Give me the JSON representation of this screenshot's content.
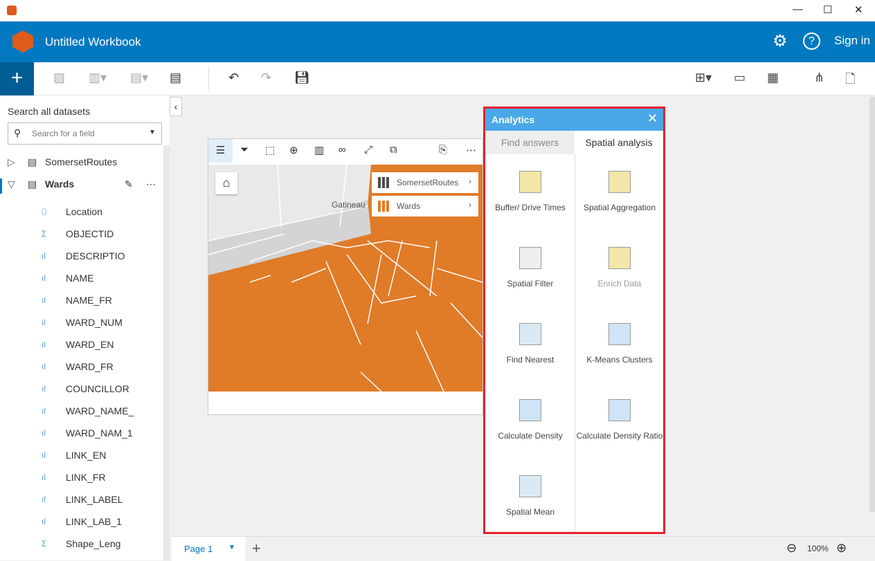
{
  "window": {
    "title": "Untitled Workbook",
    "minimize": "—",
    "maximize": "☐",
    "close": "✕"
  },
  "header": {
    "title": "Untitled Workbook",
    "sign_in": "Sign in",
    "settings_icon": "gear-icon",
    "help_icon": "help-icon"
  },
  "toolbar": {
    "add": "+"
  },
  "sidebar": {
    "search_label": "Search all datasets",
    "search_placeholder": "Search for a field",
    "datasets": [
      {
        "name": "SomersetRoutes"
      },
      {
        "name": "Wards"
      }
    ],
    "fields": [
      {
        "name": "Location",
        "type": "location"
      },
      {
        "name": "OBJECTID",
        "type": "number"
      },
      {
        "name": "DESCRIPTIO",
        "type": "string"
      },
      {
        "name": "NAME",
        "type": "string"
      },
      {
        "name": "NAME_FR",
        "type": "string"
      },
      {
        "name": "WARD_NUM",
        "type": "string"
      },
      {
        "name": "WARD_EN",
        "type": "string"
      },
      {
        "name": "WARD_FR",
        "type": "string"
      },
      {
        "name": "COUNCILLOR",
        "type": "string"
      },
      {
        "name": "WARD_NAME_",
        "type": "string"
      },
      {
        "name": "WARD_NAM_1",
        "type": "string"
      },
      {
        "name": "LINK_EN",
        "type": "string"
      },
      {
        "name": "LINK_FR",
        "type": "string"
      },
      {
        "name": "LINK_LABEL",
        "type": "string"
      },
      {
        "name": "LINK_LAB_1",
        "type": "string"
      },
      {
        "name": "Shape_Leng",
        "type": "number"
      }
    ]
  },
  "map": {
    "place_label": "Gatineau",
    "layers": [
      {
        "name": "SomersetRoutes",
        "color": "#4a4a4a"
      },
      {
        "name": "Wards",
        "color": "#e07b28"
      }
    ],
    "fill_color": "#e07b28"
  },
  "analytics": {
    "title": "Analytics",
    "tabs": [
      "Find answers",
      "Spatial analysis"
    ],
    "active_tab": "Spatial analysis",
    "tools": [
      {
        "label": "Buffer/ Drive Times",
        "enabled": true
      },
      {
        "label": "Spatial Aggregation",
        "enabled": true
      },
      {
        "label": "Spatial Filter",
        "enabled": true
      },
      {
        "label": "Enrich Data",
        "enabled": false
      },
      {
        "label": "Find Nearest",
        "enabled": true
      },
      {
        "label": "K-Means Clusters",
        "enabled": true
      },
      {
        "label": "Calculate Density",
        "enabled": true
      },
      {
        "label": "Calculate Density Ratio",
        "enabled": true
      },
      {
        "label": "Spatial Mean",
        "enabled": true
      }
    ]
  },
  "footer": {
    "page": "Page 1",
    "add_page": "+",
    "zoom": "100%",
    "zoom_out": "⊖",
    "zoom_in": "⊕"
  }
}
